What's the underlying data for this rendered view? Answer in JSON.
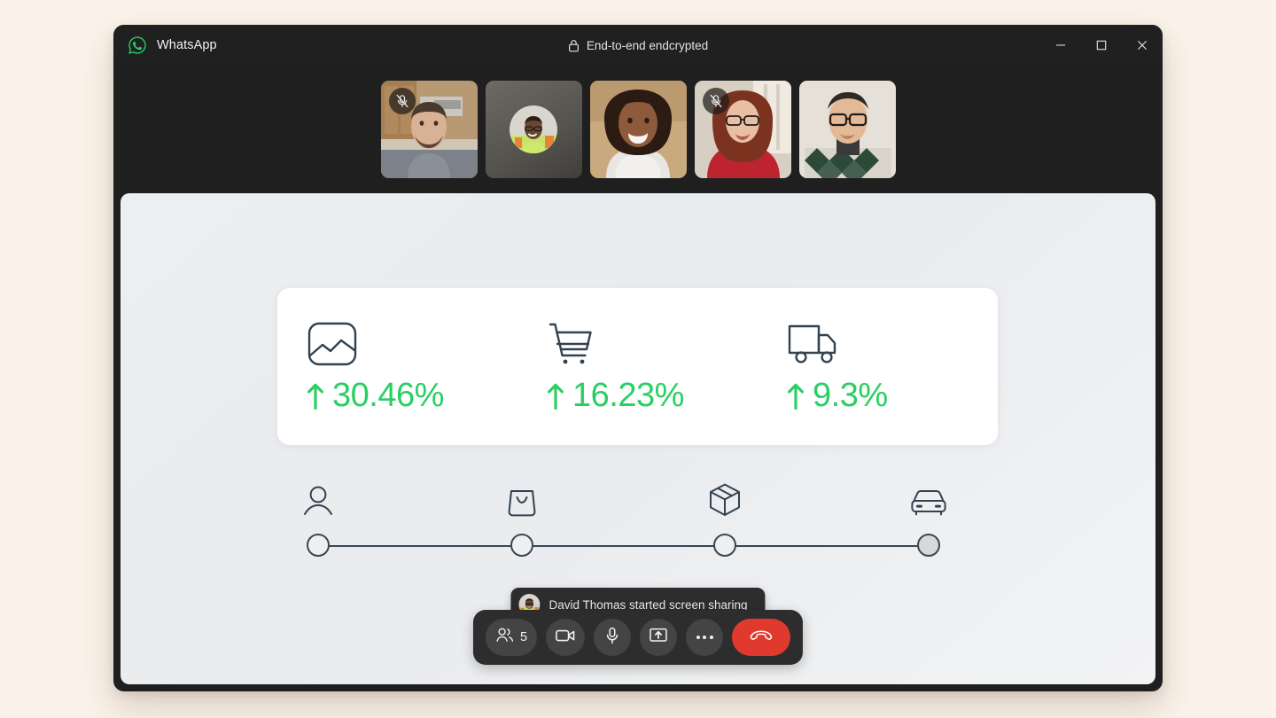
{
  "window": {
    "brand_name": "WhatsApp",
    "lock_icon": "lock-icon",
    "encryption_label": "End-to-end endcrypted",
    "controls": {
      "minimize": "minimize-button",
      "maximize": "maximize-button",
      "close": "close-button"
    }
  },
  "participants": [
    {
      "id": "p1",
      "type": "video",
      "muted": true,
      "skin": "#c9a273",
      "icon": "mic-muted-icon"
    },
    {
      "id": "p2",
      "type": "avatar",
      "muted": false,
      "skin": "#6f6a62",
      "icon": "avatar"
    },
    {
      "id": "p3",
      "type": "video",
      "muted": false,
      "skin": "#b4865f",
      "icon": ""
    },
    {
      "id": "p4",
      "type": "video",
      "muted": true,
      "skin": "#c28a78",
      "icon": "mic-muted-icon"
    },
    {
      "id": "p5",
      "type": "video",
      "muted": false,
      "skin": "#d7cdbe",
      "icon": ""
    }
  ],
  "shared_screen": {
    "accent_green": "#2ACF63",
    "ink": "#33424f",
    "stats": [
      {
        "icon": "image-chart-icon",
        "arrow": "arrow-up-icon",
        "value": "30.46%"
      },
      {
        "icon": "shopping-cart-icon",
        "arrow": "arrow-up-icon",
        "value": "16.23%"
      },
      {
        "icon": "delivery-truck-icon",
        "arrow": "arrow-up-icon",
        "value": "9.3%"
      }
    ],
    "tracker": {
      "steps": [
        {
          "icon": "user-icon",
          "filled": false
        },
        {
          "icon": "shopping-bag-icon",
          "filled": false
        },
        {
          "icon": "package-box-icon",
          "filled": false
        },
        {
          "icon": "car-icon",
          "filled": true
        }
      ]
    }
  },
  "toast": {
    "avatar": "avatar-david-thomas",
    "message": "David Thomas started screen sharing"
  },
  "controls": {
    "participants": {
      "icon": "people-icon",
      "count": "5"
    },
    "camera": {
      "icon": "video-camera-icon"
    },
    "microphone": {
      "icon": "microphone-icon"
    },
    "share": {
      "icon": "share-screen-icon"
    },
    "more": {
      "icon": "more-horizontal-icon"
    },
    "end_call": {
      "icon": "end-call-icon",
      "color": "#e03a2f"
    }
  }
}
